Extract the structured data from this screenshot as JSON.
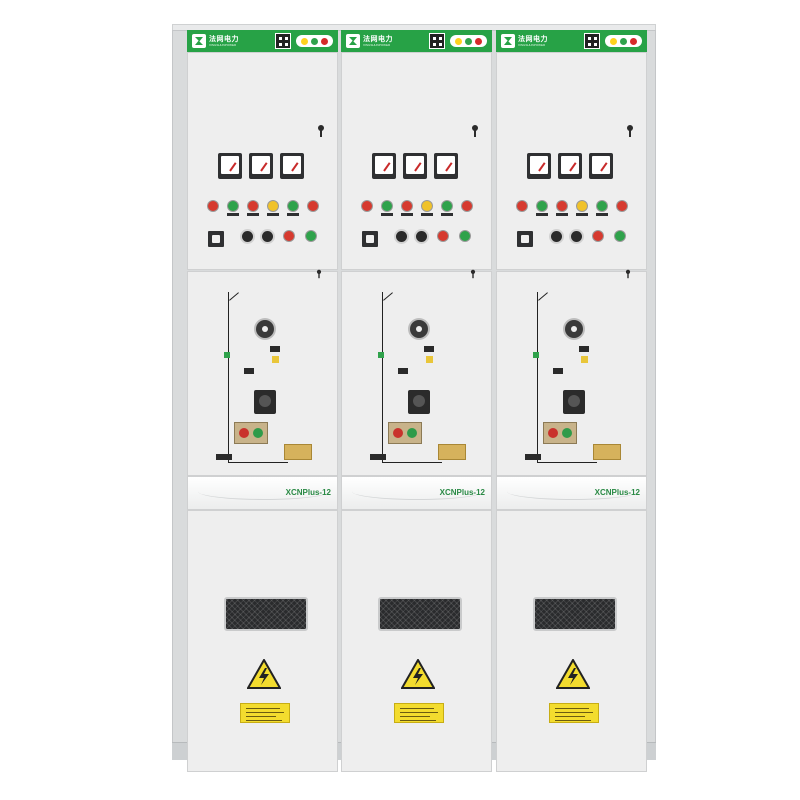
{
  "header": {
    "brand": "法网电力",
    "brand_sub": "XINGSHUNPOWER",
    "leds": [
      "#ffd21f",
      "#2fa24b",
      "#d62a2a"
    ]
  },
  "colors": {
    "header_green": "#27a246",
    "panel": "#eeeeee",
    "red_button": "#d63a2f",
    "green_button": "#2fa24b",
    "yellow_button": "#f0c22a"
  },
  "panels": [
    {
      "model": "XCNPlus-12"
    },
    {
      "model": "XCNPlus-12"
    },
    {
      "model": "XCNPlus-12"
    }
  ],
  "icons": {
    "warning": "high-voltage-warning-icon",
    "handle": "door-handle-icon"
  }
}
